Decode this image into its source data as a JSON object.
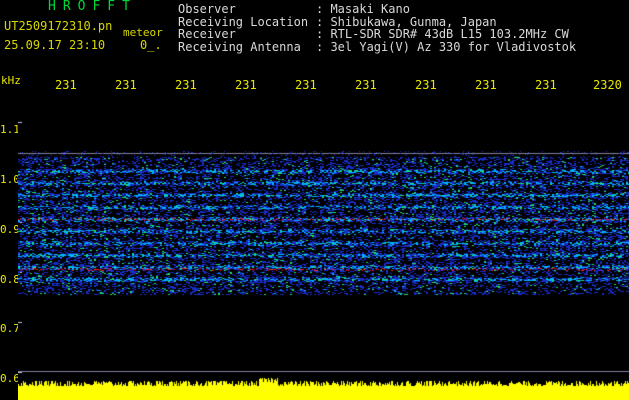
{
  "header": {
    "brand": "HROFFT",
    "filename": "UT2509172310.pn",
    "meteor_label": "meteor",
    "datetime": "25.09.17 23:10",
    "marker": "0_."
  },
  "station_info": [
    {
      "key": "Observer",
      "value": ": Masaki Kano"
    },
    {
      "key": "Receiving Location",
      "value": ": Shibukawa, Gunma, Japan"
    },
    {
      "key": "Receiver",
      "value": ": RTL-SDR SDR# 43dB L15 103.2MHz CW"
    },
    {
      "key": "Receiving Antenna",
      "value": ": 3el Yagi(V) Az 330 for Vladivostok"
    }
  ],
  "axis": {
    "y_unit": "kHz",
    "x_ticks": [
      "231",
      "231",
      "231",
      "231",
      "231",
      "231",
      "231",
      "231",
      "231",
      "2320"
    ],
    "y_ticks": [
      "1.1",
      "1.0",
      "0.9",
      "0.8",
      "0.7",
      "0.6"
    ]
  },
  "colors": {
    "background": "#000000",
    "noise_low": "#1a2cc8",
    "noise_mid": "#00b4ff",
    "noise_high": "#20e070",
    "signal": "#ff2020",
    "amplitude": "#ffff00"
  }
}
